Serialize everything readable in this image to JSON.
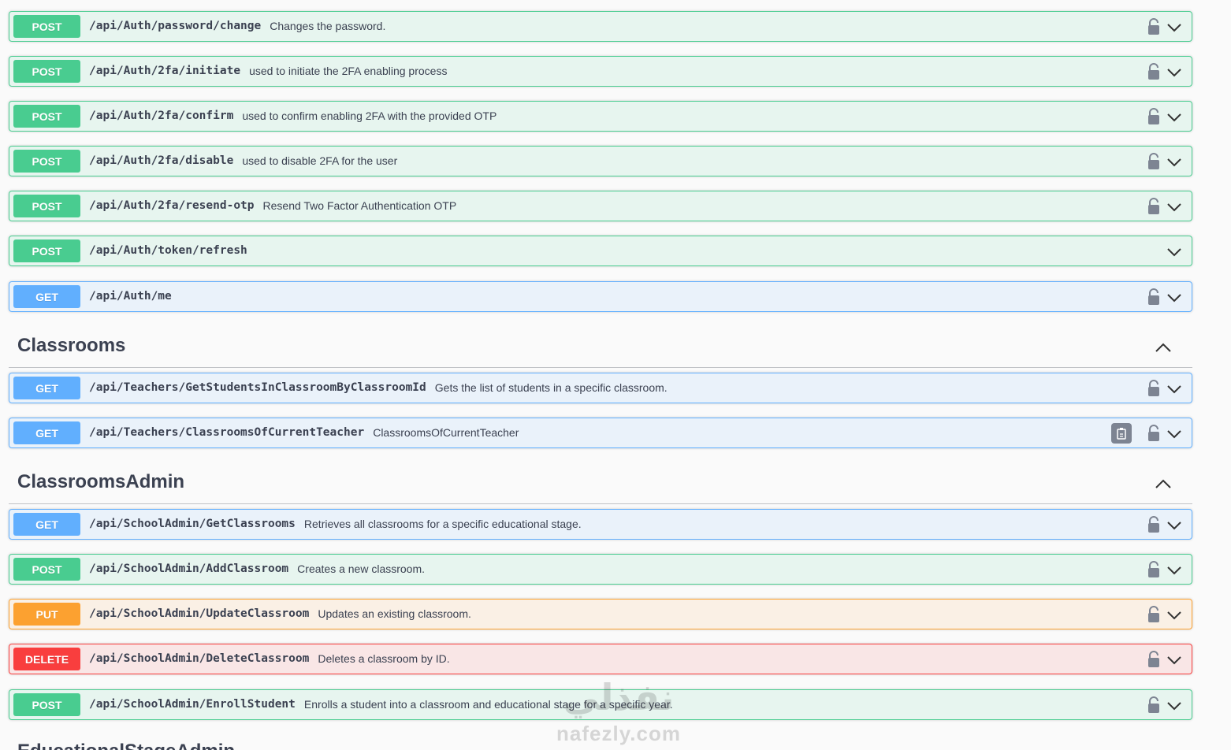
{
  "operations_auth": [
    {
      "method": "POST",
      "path": "/api/Auth/password/change",
      "desc": "Changes the password."
    },
    {
      "method": "POST",
      "path": "/api/Auth/2fa/initiate",
      "desc": "used to initiate the 2FA enabling process"
    },
    {
      "method": "POST",
      "path": "/api/Auth/2fa/confirm",
      "desc": "used to confirm enabling 2FA with the provided OTP"
    },
    {
      "method": "POST",
      "path": "/api/Auth/2fa/disable",
      "desc": "used to disable 2FA for the user"
    },
    {
      "method": "POST",
      "path": "/api/Auth/2fa/resend-otp",
      "desc": "Resend Two Factor Authentication OTP"
    },
    {
      "method": "POST",
      "path": "/api/Auth/token/refresh",
      "desc": ""
    },
    {
      "method": "GET",
      "path": "/api/Auth/me",
      "desc": ""
    }
  ],
  "tags": {
    "classrooms": "Classrooms",
    "classrooms_admin": "ClassroomsAdmin",
    "next_cut": "EducationalStageAdmin"
  },
  "operations_classrooms": [
    {
      "method": "GET",
      "path": "/api/Teachers/GetStudentsInClassroomByClassroomId",
      "desc": "Gets the list of students in a specific classroom."
    },
    {
      "method": "GET",
      "path": "/api/Teachers/ClassroomsOfCurrentTeacher",
      "desc": "ClassroomsOfCurrentTeacher"
    }
  ],
  "operations_admin": [
    {
      "method": "GET",
      "path": "/api/SchoolAdmin/GetClassrooms",
      "desc": "Retrieves all classrooms for a specific educational stage."
    },
    {
      "method": "POST",
      "path": "/api/SchoolAdmin/AddClassroom",
      "desc": "Creates a new classroom."
    },
    {
      "method": "PUT",
      "path": "/api/SchoolAdmin/UpdateClassroom",
      "desc": "Updates an existing classroom."
    },
    {
      "method": "DELETE",
      "path": "/api/SchoolAdmin/DeleteClassroom",
      "desc": "Deletes a classroom by ID."
    },
    {
      "method": "POST",
      "path": "/api/SchoolAdmin/EnrollStudent",
      "desc": "Enrolls a student into a classroom and educational stage for a specific year."
    }
  ],
  "watermark": {
    "arabic": "نفذلي",
    "latin": "nafezly.com"
  },
  "icons": {
    "lock": "lock-icon",
    "chevron": "chevron-down-icon",
    "collapse": "chevron-up-icon",
    "copy": "copy-to-clipboard-icon"
  }
}
